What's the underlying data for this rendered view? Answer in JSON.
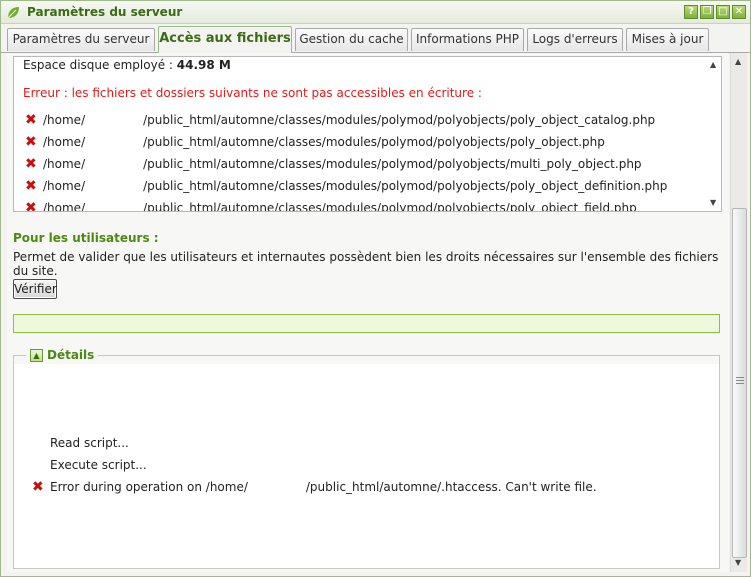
{
  "window": {
    "title": "Paramètres du serveur",
    "tools": [
      "help-icon",
      "restore-icon",
      "maximize-icon",
      "close-icon"
    ],
    "tool_glyphs": [
      "?",
      "❐",
      "□",
      "✕"
    ]
  },
  "tabs": [
    {
      "label": "Paramètres du serveur",
      "active": false
    },
    {
      "label": "Accès aux fichiers",
      "active": true
    },
    {
      "label": "Gestion du cache",
      "active": false
    },
    {
      "label": "Informations PHP",
      "active": false
    },
    {
      "label": "Logs d'erreurs",
      "active": false
    },
    {
      "label": "Mises à jour",
      "active": false
    }
  ],
  "disk": {
    "label": "Espace disque employé :",
    "value": "44.98 M"
  },
  "error_message": "Erreur : les fichiers et dossiers suivants ne sont pas accessibles en écriture :",
  "files": [
    {
      "prefix": "/home/",
      "suffix": "/public_html/automne/classes/modules/polymod/polyobjects/poly_object_catalog.php"
    },
    {
      "prefix": "/home/",
      "suffix": "/public_html/automne/classes/modules/polymod/polyobjects/poly_object.php"
    },
    {
      "prefix": "/home/",
      "suffix": "/public_html/automne/classes/modules/polymod/polyobjects/multi_poly_object.php"
    },
    {
      "prefix": "/home/",
      "suffix": "/public_html/automne/classes/modules/polymod/polyobjects/poly_object_definition.php"
    },
    {
      "prefix": "/home/",
      "suffix": "/public_html/automne/classes/modules/polymod/polyobjects/poly_object_field.php"
    }
  ],
  "users": {
    "title": "Pour les utilisateurs :",
    "description": "Permet de valider que les utilisateurs et internautes possèdent bien les droits nécessaires sur l'ensemble des fichiers du site.",
    "verify_label": "Vérifier",
    "progress": 0
  },
  "details": {
    "legend": "Détails",
    "lines": [
      "Read script...",
      "Execute script..."
    ],
    "error_prefix": "Error during operation on /home/",
    "error_suffix": "/public_html/automne/.htaccess. Can't write file."
  },
  "colors": {
    "accent": "#4d8a12",
    "error": "#e01a1a",
    "error_icon": "#c81010"
  }
}
